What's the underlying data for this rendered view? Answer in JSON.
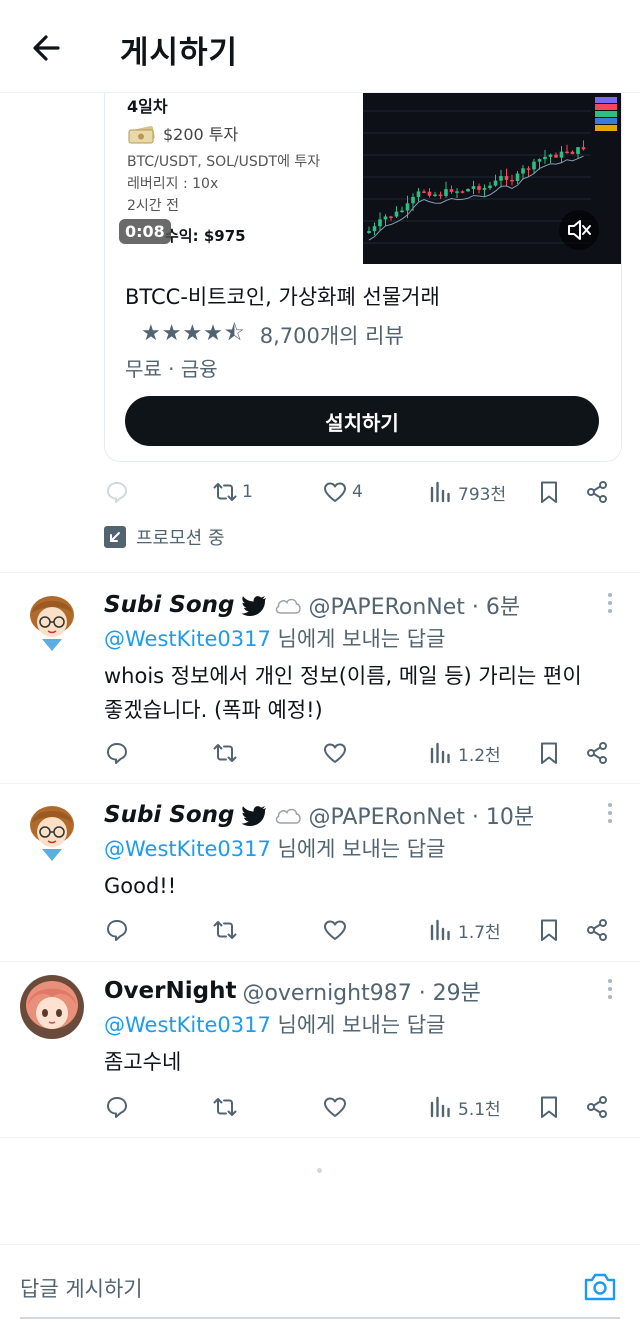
{
  "header": {
    "title": "게시하기",
    "back_icon": "arrow-left-icon"
  },
  "ad": {
    "media": {
      "day": "4일차",
      "invest": "$200 투자",
      "pairs": "BTC/USDT, SOL/USDT에 투자",
      "leverage": "레버리지 : 10x",
      "ago": "2시간 전",
      "profit": "수익: $975",
      "video_time": "0:08"
    },
    "app_name": "BTCC-비트코인, 가상화폐 선물거래",
    "rating": 4.5,
    "stars": "★★★★⯪",
    "review_count": "8,700개의 리뷰",
    "category": "무료 · 금융",
    "install_label": "설치하기"
  },
  "ad_actions": {
    "retweets": "1",
    "likes": "4",
    "views": "793천"
  },
  "promo_label": "프로모션 중",
  "replies": [
    {
      "author": "Subi Song",
      "handle": "@PAPERonNet · 6분",
      "replying_mention": "@WestKite0317",
      "replying_suffix": " 님에게 보내는 답글",
      "text": "whois 정보에서 개인 정보(이름, 메일 등) 가리는 편이 좋겠습니다. (폭파 예정!)",
      "views": "1.2천"
    },
    {
      "author": "Subi Song",
      "handle": "@PAPERonNet · 10분",
      "replying_mention": "@WestKite0317",
      "replying_suffix": " 님에게 보내는 답글",
      "text": "Good!!",
      "views": "1.7천"
    },
    {
      "author": "OverNight",
      "handle": "@overnight987 · 29분",
      "replying_mention": "@WestKite0317",
      "replying_suffix": " 님에게 보내는 답글",
      "text": "좀고수네",
      "views": "5.1천"
    }
  ],
  "reply_bar": {
    "placeholder": "답글 게시하기"
  },
  "colors": {
    "accent": "#1d9bf0",
    "text": "#0f1419",
    "muted": "#536471"
  }
}
